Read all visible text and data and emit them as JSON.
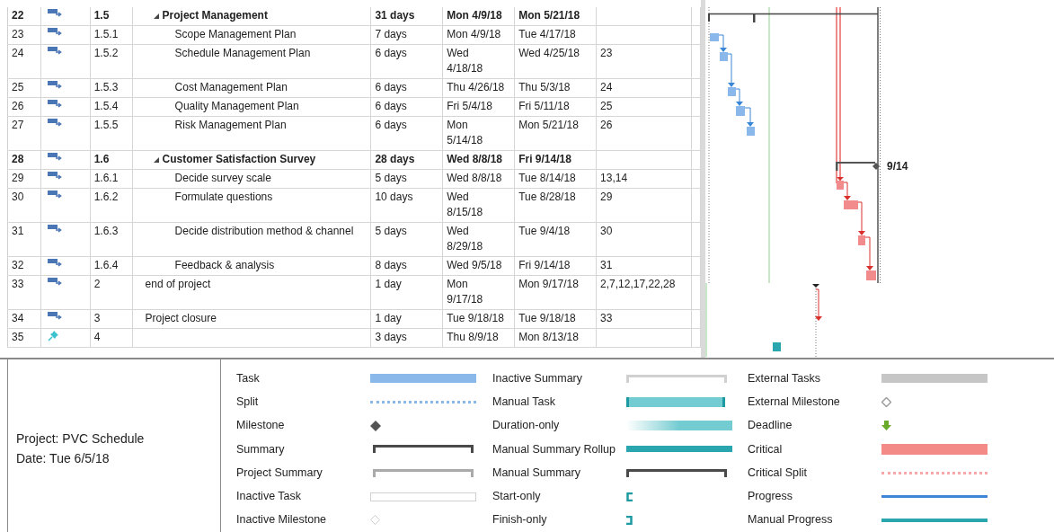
{
  "tasks": [
    {
      "id": "22",
      "kind": "auto",
      "wbs": "1.5",
      "name": "Project Management",
      "summary": true,
      "expanded": true,
      "duration": "31 days",
      "start": "Mon 4/9/18",
      "finish": "Mon 5/21/18",
      "children": [
        {
          "id": "23",
          "kind": "auto",
          "wbs": "1.5.1",
          "name": "Scope Management Plan",
          "summary": false,
          "duration": "7 days",
          "start": "Mon 4/9/18",
          "finish": "Tue 4/17/18"
        },
        {
          "id": "24",
          "kind": "auto",
          "wbs": "1.5.2",
          "name": "Schedule Management Plan",
          "summary": false,
          "duration": "6 days",
          "start": "Wed 4/18/18",
          "finish": "Wed 4/25/18",
          "predecessors": "23"
        },
        {
          "id": "25",
          "kind": "auto",
          "wbs": "1.5.3",
          "name": "Cost Management Plan",
          "summary": false,
          "duration": "6 days",
          "start": "Thu 4/26/18",
          "finish": "Thu 5/3/18",
          "predecessors": "24"
        },
        {
          "id": "26",
          "kind": "auto",
          "wbs": "1.5.4",
          "name": "Quality Management Plan",
          "summary": false,
          "duration": "6 days",
          "start": "Fri 5/4/18",
          "finish": "Fri 5/11/18",
          "predecessors": "25"
        },
        {
          "id": "27",
          "kind": "auto",
          "wbs": "1.5.5",
          "name": "Risk Management Plan",
          "summary": false,
          "duration": "6 days",
          "start": "Mon 5/14/18",
          "finish": "Mon 5/21/18",
          "predecessors": "26"
        }
      ]
    },
    {
      "id": "28",
      "kind": "auto",
      "wbs": "1.6",
      "name": "Customer Satisfaction Survey",
      "summary": true,
      "expanded": true,
      "duration": "28 days",
      "start": "Wed 8/8/18",
      "finish": "Fri 9/14/18",
      "children": [
        {
          "id": "29",
          "kind": "auto",
          "wbs": "1.6.1",
          "name": "Decide survey scale",
          "summary": false,
          "duration": "5 days",
          "start": "Wed 8/8/18",
          "finish": "Tue 8/14/18",
          "predecessors": "13,14"
        },
        {
          "id": "30",
          "kind": "auto",
          "wbs": "1.6.2",
          "name": "Formulate questions",
          "summary": false,
          "duration": "10 days",
          "start": "Wed 8/15/18",
          "finish": "Tue 8/28/18",
          "predecessors": "29"
        },
        {
          "id": "31",
          "kind": "auto",
          "wbs": "1.6.3",
          "name": "Decide distribution method & channel",
          "summary": false,
          "duration": "5 days",
          "start": "Wed 8/29/18",
          "finish": "Tue 9/4/18",
          "predecessors": "30"
        },
        {
          "id": "32",
          "kind": "auto",
          "wbs": "1.6.4",
          "name": "Feedback & analysis",
          "summary": false,
          "duration": "8 days",
          "start": "Wed 9/5/18",
          "finish": "Fri 9/14/18",
          "predecessors": "31"
        }
      ]
    },
    {
      "id": "33",
      "kind": "auto",
      "wbs": "2",
      "name": "end of project",
      "summary": false,
      "duration": "1 day",
      "start": "Mon 9/17/18",
      "finish": "Mon 9/17/18",
      "predecessors": "2,7,12,17,22,28"
    },
    {
      "id": "34",
      "kind": "auto",
      "wbs": "3",
      "name": "Project closure",
      "summary": false,
      "duration": "1 day",
      "start": "Tue 9/18/18",
      "finish": "Tue 9/18/18",
      "predecessors": "33"
    },
    {
      "id": "35",
      "kind": "manual",
      "wbs": "4",
      "summary": false,
      "duration": "3 days",
      "start": "Thu 8/9/18",
      "finish": "Mon 8/13/18"
    }
  ],
  "gantt": {
    "finish_label": "9/14"
  },
  "legend": {
    "project": "Project: PVC Schedule",
    "date": "Date: Tue 6/5/18",
    "columns": [
      [
        {
          "label": "Task",
          "kind": "task"
        },
        {
          "label": "Split",
          "kind": "split"
        },
        {
          "label": "Milestone",
          "kind": "milestone"
        },
        {
          "label": "Summary",
          "kind": "summary"
        },
        {
          "label": "Project Summary",
          "kind": "project_summary"
        },
        {
          "label": "Inactive Task",
          "kind": "inactive_task"
        },
        {
          "label": "Inactive Milestone",
          "kind": "inactive_milestone"
        }
      ],
      [
        {
          "label": "Inactive Summary",
          "kind": "inactive_summary"
        },
        {
          "label": "Manual Task",
          "kind": "manual_task"
        },
        {
          "label": "Duration-only",
          "kind": "duration_only"
        },
        {
          "label": "Manual Summary Rollup",
          "kind": "manual_summary_rollup"
        },
        {
          "label": "Manual Summary",
          "kind": "manual_summary"
        },
        {
          "label": "Start-only",
          "kind": "start_only"
        },
        {
          "label": "Finish-only",
          "kind": "finish_only"
        }
      ],
      [
        {
          "label": "External Tasks",
          "kind": "external_tasks"
        },
        {
          "label": "External Milestone",
          "kind": "external_milestone"
        },
        {
          "label": "Deadline",
          "kind": "deadline"
        },
        {
          "label": "Critical",
          "kind": "critical"
        },
        {
          "label": "Critical Split",
          "kind": "critical_split"
        },
        {
          "label": "Progress",
          "kind": "progress"
        },
        {
          "label": "Manual Progress",
          "kind": "manual_progress"
        }
      ]
    ]
  }
}
